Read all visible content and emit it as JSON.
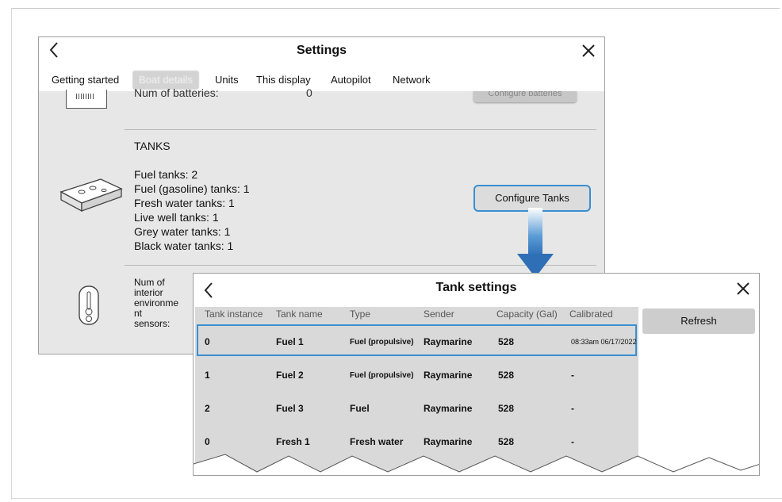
{
  "settings": {
    "title": "Settings",
    "tabs": [
      {
        "label": "Getting started"
      },
      {
        "label": "Boat details"
      },
      {
        "label": "Units"
      },
      {
        "label": "This display"
      },
      {
        "label": "Autopilot"
      },
      {
        "label": "Network"
      }
    ],
    "active_tab_index": 1,
    "batteries": {
      "label": "Num of batteries:",
      "value": "0",
      "button": "Configure batteries"
    },
    "tanks": {
      "title": "TANKS",
      "lines": [
        "Fuel tanks: 2",
        "Fuel (gasoline) tanks: 1",
        "Fresh water tanks: 1",
        "Live well tanks: 1",
        "Grey water tanks: 1",
        "Black water tanks: 1"
      ],
      "button": "Configure Tanks"
    },
    "environment": {
      "label_lines": [
        "Num of",
        "interior",
        "environme",
        "nt",
        "sensors:"
      ]
    }
  },
  "tank_settings": {
    "title": "Tank settings",
    "refresh_button": "Refresh",
    "columns": [
      "Tank instance",
      "Tank name",
      "Type",
      "Sender",
      "Capacity (Gal)",
      "Calibrated"
    ],
    "rows": [
      {
        "instance": "0",
        "name": "Fuel 1",
        "type": "Fuel (propulsive)",
        "sender": "Raymarine",
        "capacity": "528",
        "calibrated": "08:33am 06/17/2022",
        "selected": true
      },
      {
        "instance": "1",
        "name": "Fuel 2",
        "type": "Fuel (propulsive)",
        "sender": "Raymarine",
        "capacity": "528",
        "calibrated": "-"
      },
      {
        "instance": "2",
        "name": "Fuel 3",
        "type": "Fuel",
        "sender": "Raymarine",
        "capacity": "528",
        "calibrated": "-"
      },
      {
        "instance": "0",
        "name": "Fresh 1",
        "type": "Fresh water",
        "sender": "Raymarine",
        "capacity": "528",
        "calibrated": "-"
      }
    ]
  },
  "colors": {
    "selection_blue": "#3a8fd0",
    "arrow_blue": "#2f6fb6"
  }
}
